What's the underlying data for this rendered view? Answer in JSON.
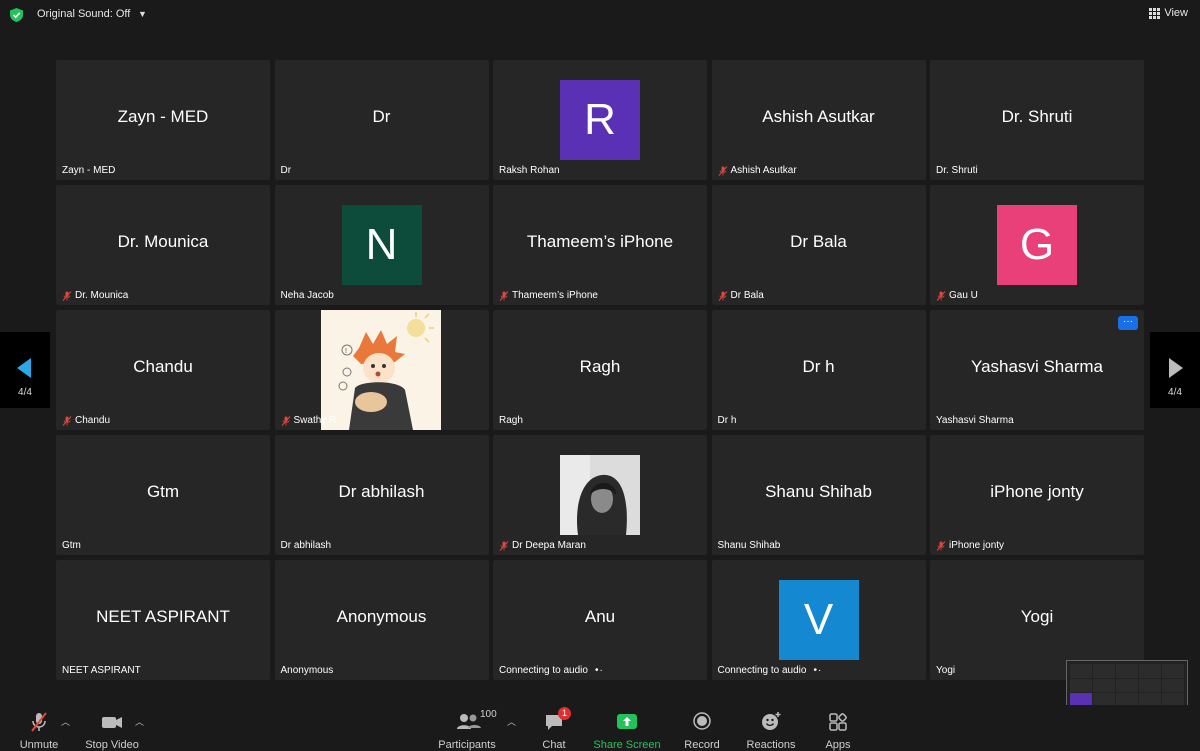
{
  "topbar": {
    "original_sound": "Original Sound: Off",
    "view": "View"
  },
  "pager": {
    "left": "4/4",
    "right": "4/4"
  },
  "colors": {
    "accent_green": "#24c25c",
    "mute_red": "#e0483e",
    "blue": "#1a6fe8"
  },
  "tiles": [
    {
      "big": "Zayn - MED",
      "name": "Zayn - MED",
      "muted": false
    },
    {
      "big": "Dr",
      "name": "Dr",
      "muted": false
    },
    {
      "avatar": "R",
      "avatar_color": "#5a31b4",
      "name": "Raksh Rohan",
      "muted": false
    },
    {
      "big": "Ashish Asutkar",
      "name": "Ashish Asutkar",
      "muted": true
    },
    {
      "big": "Dr. Shruti",
      "name": "Dr. Shruti",
      "muted": false
    },
    {
      "big": "Dr. Mounica",
      "name": "Dr. Mounica",
      "muted": true
    },
    {
      "avatar": "N",
      "avatar_color": "#0d4b3a",
      "name": "Neha Jacob",
      "muted": false
    },
    {
      "big": "Thameem’s iPhone",
      "name": "Thameem’s iPhone",
      "muted": true
    },
    {
      "big": "Dr Bala",
      "name": "Dr Bala",
      "muted": true
    },
    {
      "avatar": "G",
      "avatar_color": "#e9407a",
      "name": "Gau U",
      "muted": true
    },
    {
      "big": "Chandu",
      "name": "Chandu",
      "muted": true
    },
    {
      "image": "anime",
      "name": "Swathy R",
      "muted": true
    },
    {
      "big": "Ragh",
      "name": "Ragh",
      "muted": false
    },
    {
      "big": "Dr h",
      "name": "Dr h",
      "muted": false
    },
    {
      "big": "Yashasvi Sharma",
      "name": "Yashasvi Sharma",
      "muted": false,
      "more": "···"
    },
    {
      "big": "Gtm",
      "name": "Gtm",
      "muted": false
    },
    {
      "big": "Dr abhilash",
      "name": "Dr abhilash",
      "muted": false
    },
    {
      "image": "photo",
      "name": "Dr Deepa Maran",
      "muted": true
    },
    {
      "big": "Shanu Shihab",
      "name": "Shanu Shihab",
      "muted": false
    },
    {
      "big": "iPhone jonty",
      "name": "iPhone jonty",
      "muted": true
    },
    {
      "big": "NEET ASPIRANT",
      "name": "NEET ASPIRANT",
      "muted": false
    },
    {
      "big": "Anonymous",
      "name": "Anonymous",
      "muted": false
    },
    {
      "big": "Anu",
      "name": "Connecting to audio",
      "muted": false,
      "connecting": true
    },
    {
      "avatar": "V",
      "avatar_color": "#1488d1",
      "name": "Connecting to audio",
      "muted": false,
      "connecting": true
    },
    {
      "big": "Yogi",
      "name": "Yogi",
      "muted": false
    }
  ],
  "toolbar": {
    "unmute": "Unmute",
    "stop_video": "Stop Video",
    "participants": "Participants",
    "participants_count": "100",
    "chat": "Chat",
    "chat_badge": "1",
    "share_screen": "Share Screen",
    "record": "Record",
    "reactions": "Reactions",
    "apps": "Apps"
  }
}
